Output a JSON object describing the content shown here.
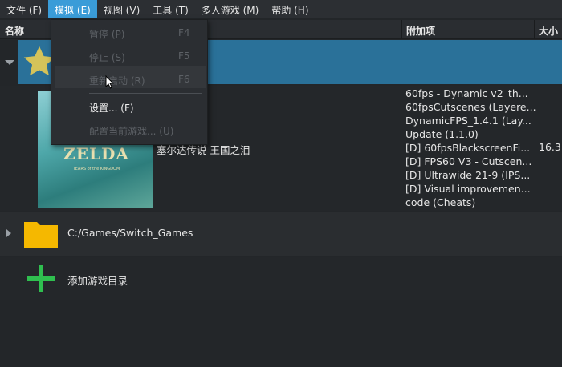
{
  "menubar": [
    "文件 (F)",
    "模拟 (E)",
    "视图 (V)",
    "工具 (T)",
    "多人游戏 (M)",
    "帮助 (H)"
  ],
  "columns": {
    "name": "名称",
    "addons": "附加项",
    "size": "大小"
  },
  "game": {
    "title": "塞尔达传说 王国之泪",
    "cover_text": "ZELDA",
    "cover_sub": "TEARS of the KINGDOM",
    "size": "16.3",
    "addons": [
      "60fps - Dynamic v2_th...",
      "60fpsCutscenes (Layere...",
      "DynamicFPS_1.4.1 (Lay...",
      "Update (1.1.0)",
      "[D] 60fpsBlackscreenFi...",
      "[D] FPS60 V3 - Cutscen...",
      "[D] Ultrawide 21-9 (IPS...",
      "[D] Visual improvemen...",
      "code (Cheats)"
    ]
  },
  "folder": {
    "path": "C:/Games/Switch_Games"
  },
  "add_dir": {
    "label": "添加游戏目录"
  },
  "emulation_menu": [
    {
      "label": "暂停 (P)",
      "shortcut": "F4"
    },
    {
      "label": "停止 (S)",
      "shortcut": "F5"
    },
    {
      "label": "重新启动 (R)",
      "shortcut": "F6"
    },
    {
      "label": "设置... (F)",
      "shortcut": ""
    },
    {
      "label": "配置当前游戏... (U)",
      "shortcut": ""
    }
  ],
  "colors": {
    "selected": "#2a7199",
    "menu_active": "#3a9cd8",
    "star": "#d4c35a",
    "folder": "#f5b800",
    "plus": "#2fbf4f"
  }
}
